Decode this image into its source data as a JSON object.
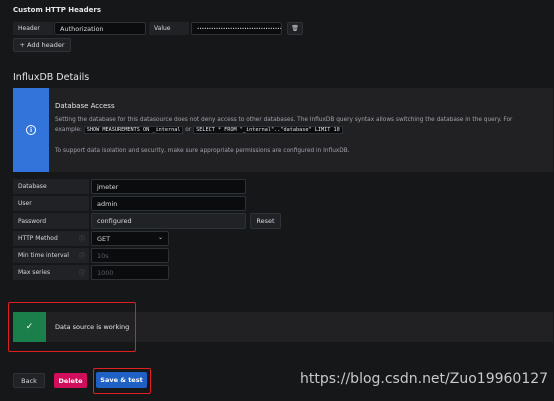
{
  "custom_headers": {
    "title": "Custom HTTP Headers",
    "header_label": "Header",
    "header_value": "Authorization",
    "value_label": "Value",
    "value_masked": "••••••••••••••••••••••••••••••••••••",
    "add_header_label": "+ Add header"
  },
  "influxdb": {
    "title": "InfluxDB Details",
    "info": {
      "heading": "Database Access",
      "line1": "Setting the database for this datasource does not deny access to other databases. The InfluxDB query syntax allows switching the database in the query. For",
      "line2_prefix": "example:",
      "code1": "SHOW MEASUREMENTS ON _internal",
      "line2_or": "or",
      "code2": "SELECT * FROM \"_internal\"..\"database\" LIMIT 10",
      "line3": "To support data isolation and security, make sure appropriate permissions are configured in InfluxDB.",
      "icon": "info-icon"
    },
    "fields": {
      "database_label": "Database",
      "database_value": "jmeter",
      "user_label": "User",
      "user_value": "admin",
      "password_label": "Password",
      "password_value": "configured",
      "reset_label": "Reset",
      "http_method_label": "HTTP Method",
      "http_method_value": "GET",
      "min_time_label": "Min time interval",
      "min_time_placeholder": "10s",
      "max_series_label": "Max series",
      "max_series_placeholder": "1000"
    }
  },
  "status": {
    "message": "Data source is working",
    "icon": "check-icon"
  },
  "actions": {
    "back_label": "Back",
    "delete_label": "Delete",
    "save_label": "Save & test"
  },
  "watermark": "https://blog.csdn.net/Zuo19960127",
  "colors": {
    "background": "#161719",
    "info_blue": "#3274d9",
    "success_green": "#1a7f4b",
    "delete_pink": "#d10e5c",
    "save_blue": "#1f60c4",
    "highlight_red": "#e02020"
  }
}
